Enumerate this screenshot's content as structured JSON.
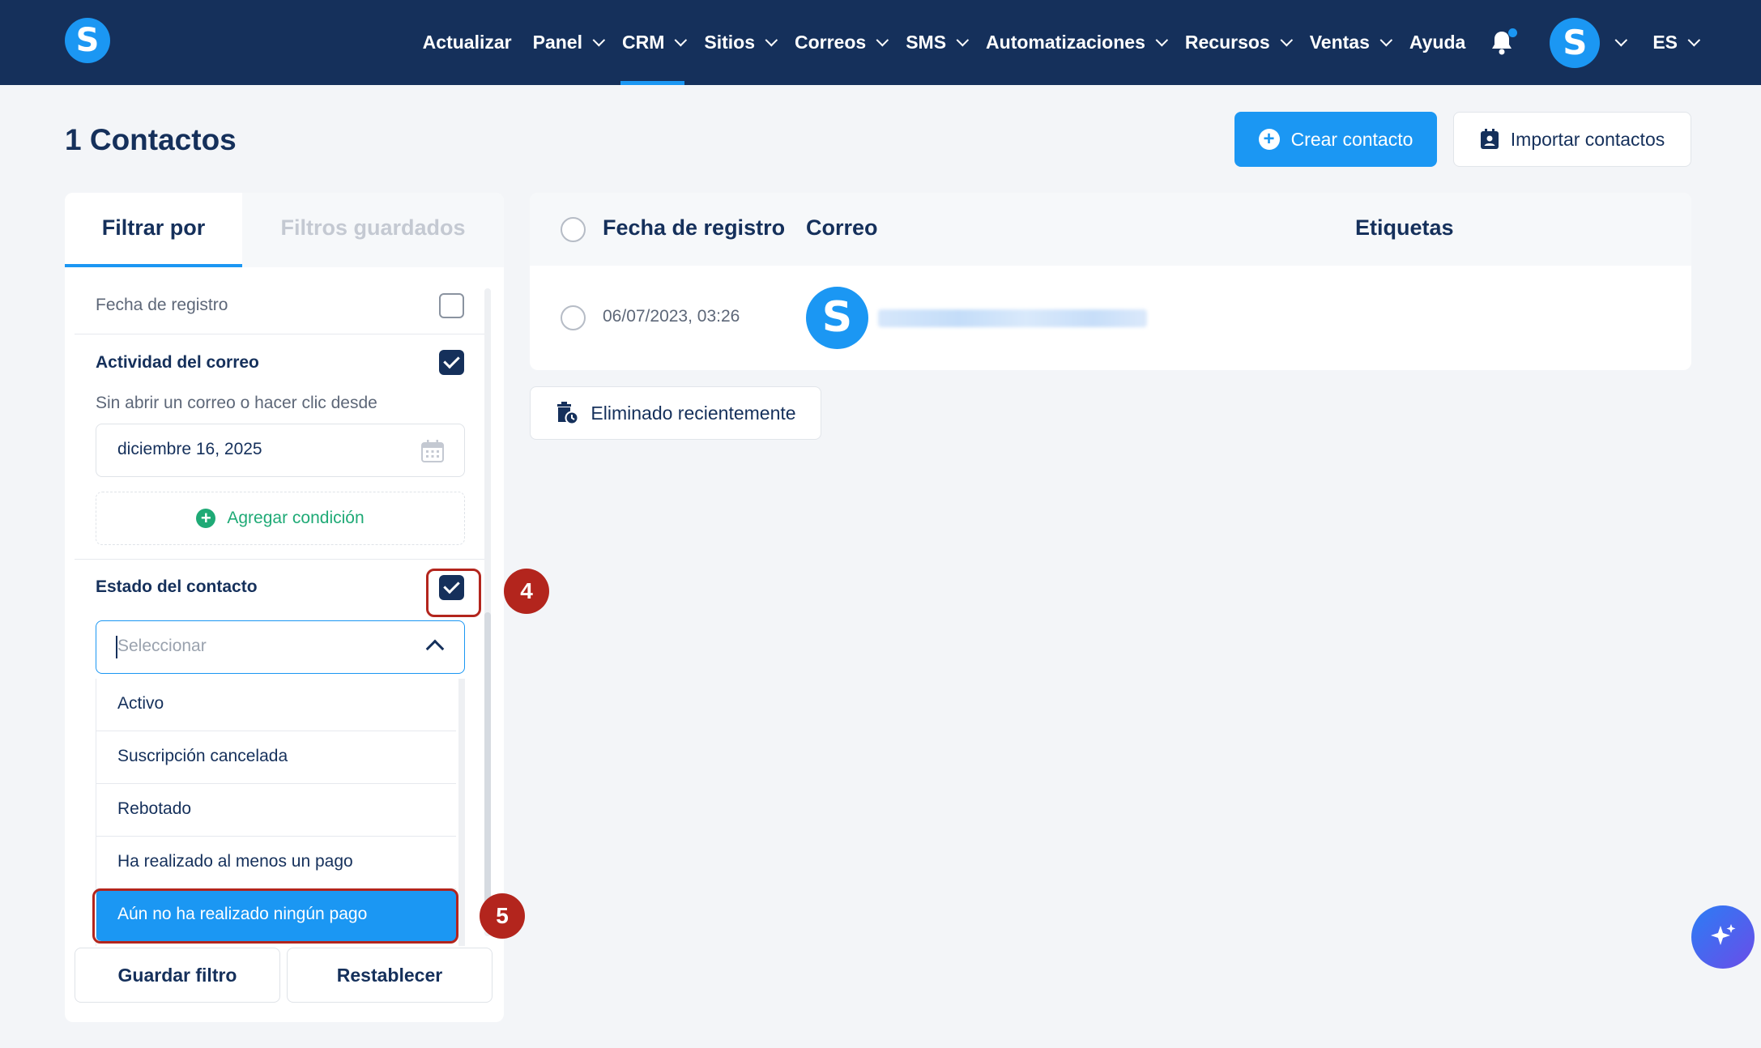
{
  "nav": {
    "items": [
      {
        "label": "Actualizar",
        "dropdown": false
      },
      {
        "label": "Panel",
        "dropdown": true
      },
      {
        "label": "CRM",
        "dropdown": true,
        "active": true
      },
      {
        "label": "Sitios",
        "dropdown": true
      },
      {
        "label": "Correos",
        "dropdown": true
      },
      {
        "label": "SMS",
        "dropdown": true
      },
      {
        "label": "Automatizaciones",
        "dropdown": true
      },
      {
        "label": "Recursos",
        "dropdown": true
      },
      {
        "label": "Ventas",
        "dropdown": true
      },
      {
        "label": "Ayuda",
        "dropdown": false
      }
    ],
    "language": "ES",
    "logo_letter": "S",
    "avatar_letter": "S"
  },
  "header": {
    "title": "1 Contactos",
    "create_button": "Crear contacto",
    "import_button": "Importar contactos"
  },
  "filter_panel": {
    "tab_filter": "Filtrar por",
    "tab_saved": "Filtros guardados",
    "registration_date_label": "Fecha de registro",
    "email_activity_label": "Actividad del correo",
    "email_activity_desc": "Sin abrir un correo o hacer clic desde",
    "email_activity_date": "diciembre 16, 2025",
    "add_condition": "Agregar condición",
    "contact_status_label": "Estado del contacto",
    "select_placeholder": "Seleccionar",
    "status_options": [
      "Activo",
      "Suscripción cancelada",
      "Rebotado",
      "Ha realizado al menos un pago",
      "Aún no ha realizado ningún pago"
    ],
    "selected_option": "Aún no ha realizado ningún pago",
    "save_filter": "Guardar filtro",
    "reset": "Restablecer"
  },
  "table": {
    "columns": [
      "Fecha de registro",
      "Correo",
      "Etiquetas"
    ],
    "rows": [
      {
        "date": "06/07/2023, 03:26",
        "avatar_letter": "S"
      }
    ]
  },
  "recently_deleted": "Eliminado recientemente",
  "annotations": {
    "step4": "4",
    "step5": "5"
  },
  "colors": {
    "nav_bg": "#15305b",
    "accent": "#1b97f3",
    "annotation": "#b3251d",
    "add_condition": "#1faa76"
  }
}
